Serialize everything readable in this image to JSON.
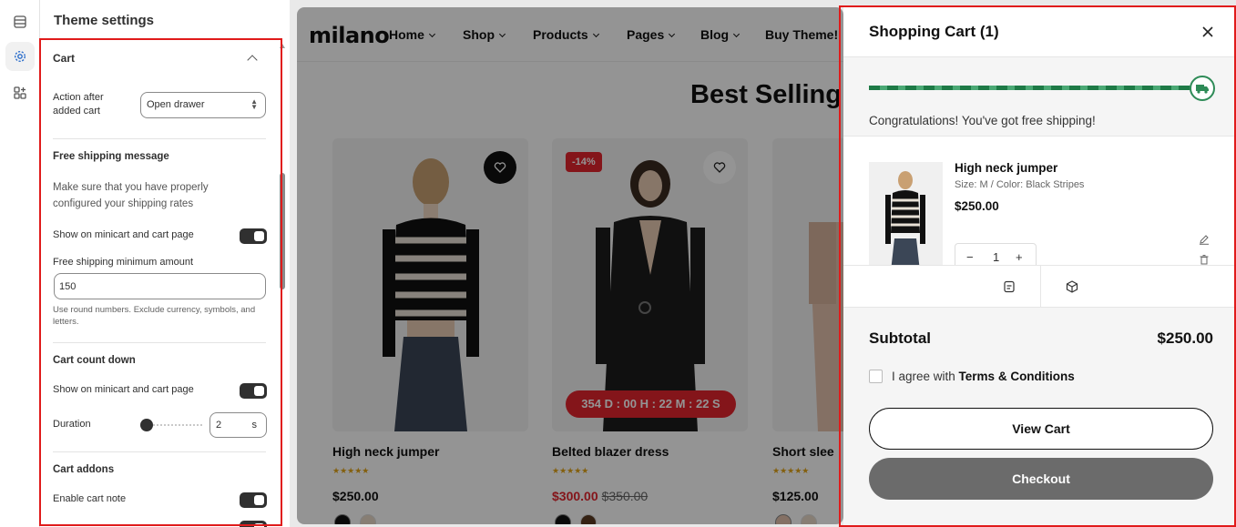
{
  "settings": {
    "title": "Theme settings",
    "cart_section": "Cart",
    "action_after_label": "Action after added cart",
    "action_after_value": "Open drawer",
    "free_ship_heading": "Free shipping message",
    "free_ship_desc": "Make sure that you have properly configured your shipping rates",
    "show_on_minicart_1": "Show on minicart and cart page",
    "free_ship_min_label": "Free shipping minimum amount",
    "free_ship_min_value": "150",
    "free_ship_help": "Use round numbers. Exclude currency, symbols, and letters.",
    "countdown_heading": "Cart count down",
    "show_on_minicart_2": "Show on minicart and cart page",
    "duration_label": "Duration",
    "duration_value": "2",
    "duration_unit": "s",
    "duration_level": 0.02,
    "addons_heading": "Cart addons",
    "enable_note_label": "Enable cart note"
  },
  "store": {
    "logo": "milano",
    "nav": [
      "Home",
      "Shop",
      "Products",
      "Pages",
      "Blog",
      "Buy Theme!"
    ],
    "heading": "Best Selling",
    "products": [
      {
        "name": "High neck jumper",
        "price": "$250.00",
        "stars": "★★★★★"
      },
      {
        "name": "Belted blazer dress",
        "sale_price": "$300.00",
        "old_price": "$350.00",
        "badge": "-14%",
        "countdown": "354 D : 00 H : 22 M : 22 S",
        "stars": "★★★★★"
      },
      {
        "name": "Short slee",
        "price": "$125.00",
        "stars": "★★★★★"
      }
    ]
  },
  "cart": {
    "title": "Shopping Cart (1)",
    "progress": 1.0,
    "congrats": "Congratulations! You've got free shipping!",
    "item": {
      "name": "High neck jumper",
      "variant": "Size: M /  Color: Black Stripes",
      "price": "$250.00",
      "qty": "1"
    },
    "subtotal_label": "Subtotal",
    "subtotal_value": "$250.00",
    "agree_prefix": "I agree with ",
    "agree_link": "Terms & Conditions",
    "view_cart": "View Cart",
    "checkout": "Checkout"
  },
  "colors": {
    "accent_red": "#e4252e",
    "progress_green": "#2e8b57",
    "highlight": "#e01b1b"
  },
  "icons": {
    "rail": [
      "sections-icon",
      "settings-gear-icon",
      "app-blocks-icon"
    ],
    "cart_tools": [
      "note-icon",
      "shipping-box-icon"
    ]
  }
}
